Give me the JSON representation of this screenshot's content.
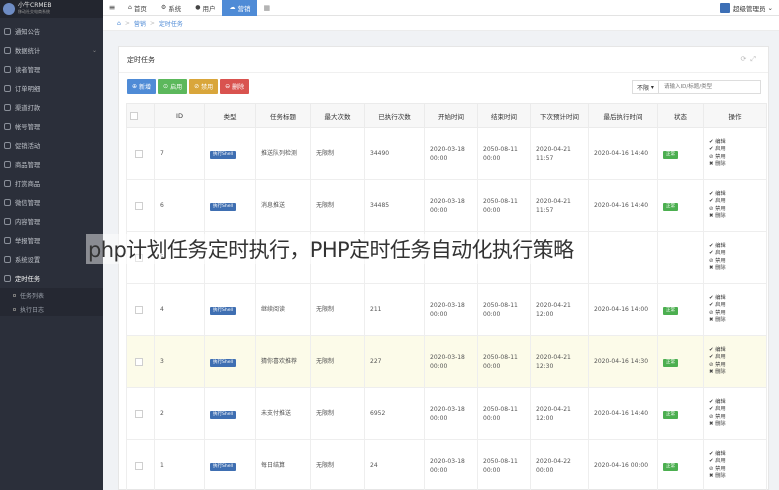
{
  "brand": {
    "title": "小牛CRMEB",
    "subtitle": "移动社交电商系统"
  },
  "sidebar": {
    "items": [
      {
        "label": "通知公告"
      },
      {
        "label": "数据统计"
      },
      {
        "label": "读者管理"
      },
      {
        "label": "订单明细"
      },
      {
        "label": "渠道打款"
      },
      {
        "label": "帐号管理"
      },
      {
        "label": "促销活动"
      },
      {
        "label": "商品管理"
      },
      {
        "label": "打赏商品"
      },
      {
        "label": "微信管理"
      },
      {
        "label": "内容管理"
      },
      {
        "label": "举报管理"
      },
      {
        "label": "系统设置"
      },
      {
        "label": "定时任务"
      }
    ],
    "subitems": [
      {
        "label": "任务列表"
      },
      {
        "label": "执行日志"
      }
    ]
  },
  "topbar": {
    "tabs": [
      {
        "label": "首页",
        "icon": "home-icon"
      },
      {
        "label": "系统",
        "icon": "gear-icon"
      },
      {
        "label": "用户",
        "icon": "user-icon"
      },
      {
        "label": "营销",
        "icon": "cloud-icon"
      }
    ],
    "admin_name": "超级管理员"
  },
  "breadcrumb": {
    "first": "营销",
    "second": "定时任务"
  },
  "panel": {
    "title": "定时任务"
  },
  "toolbar": {
    "add": "新增",
    "enable": "启用",
    "disable": "禁用",
    "delete": "删除",
    "filter_select": "不限",
    "search_placeholder": "请输入ID/标题/类型"
  },
  "table": {
    "headers": [
      "ID",
      "类型",
      "任务标题",
      "最大次数",
      "已执行次数",
      "开始时间",
      "结束时间",
      "下次预计时间",
      "最后执行时间",
      "状态",
      "操作"
    ],
    "type_badge": "执行Shell",
    "status_badge": "正常",
    "ops": [
      "✔ 编辑",
      "✔ 启用",
      "⊘ 禁用",
      "✖ 删除"
    ],
    "rows": [
      {
        "id": "7",
        "title": "推送队列检测",
        "max": "无限制",
        "count": "34490",
        "start": "2020-03-18 00:00",
        "end": "2050-08-11 00:00",
        "next": "2020-04-21 11:57",
        "last": "2020-04-16 14:40"
      },
      {
        "id": "6",
        "title": "消息推送",
        "max": "无限制",
        "count": "34485",
        "start": "2020-03-18 00:00",
        "end": "2050-08-11 00:00",
        "next": "2020-04-21 11:57",
        "last": "2020-04-16 14:40"
      },
      {
        "id": "5",
        "title": "",
        "max": "",
        "count": "",
        "start": "",
        "end": "",
        "next": "",
        "last": ""
      },
      {
        "id": "4",
        "title": "继续阅读",
        "max": "无限制",
        "count": "211",
        "start": "2020-03-18 00:00",
        "end": "2050-08-11 00:00",
        "next": "2020-04-21 12:00",
        "last": "2020-04-16 14:00"
      },
      {
        "id": "3",
        "title": "猜你喜欢推荐",
        "max": "无限制",
        "count": "227",
        "start": "2020-03-18 00:00",
        "end": "2050-08-11 00:00",
        "next": "2020-04-21 12:30",
        "last": "2020-04-16 14:30"
      },
      {
        "id": "2",
        "title": "未支付推送",
        "max": "无限制",
        "count": "6952",
        "start": "2020-03-18 00:00",
        "end": "2050-08-11 00:00",
        "next": "2020-04-21 12:00",
        "last": "2020-04-16 14:40"
      },
      {
        "id": "1",
        "title": "每日结算",
        "max": "无限制",
        "count": "24",
        "start": "2020-03-18 00:00",
        "end": "2050-08-11 00:00",
        "next": "2020-04-22 00:00",
        "last": "2020-04-16 00:00"
      }
    ]
  },
  "caption": "php计划任务定时执行，PHP定时任务自动化执行策略",
  "colors": {
    "sidebar": "#2b2f3a",
    "accent": "#4f8bd6",
    "success": "#5cb85c",
    "warning": "#d9a63b",
    "danger": "#d9534f"
  }
}
